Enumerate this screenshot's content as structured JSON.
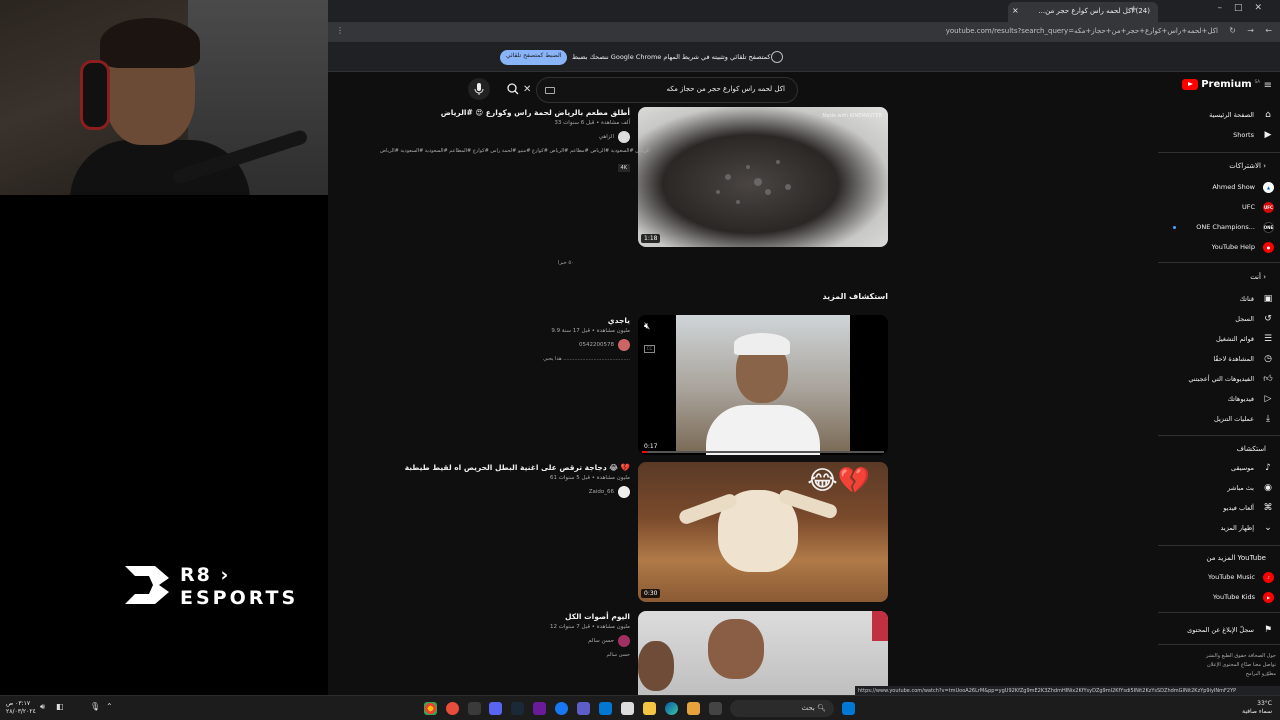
{
  "browser": {
    "tab_title": "(24) اكل لحمه راس كوارع حجر من...",
    "tab_close": "×",
    "new_tab": "+",
    "url": "youtube.com/results?search_query=اكل+لحمه+راس+كوارع+حجر+من+حجاز+مكه",
    "infobar_text": "ننصحك بضبط Google Chrome كمتصفح تلقائي وتثبيته في شريط المهام",
    "infobar_button": "الضبط كمتصفح تلقائي"
  },
  "youtube": {
    "logo_text": "Premium",
    "logo_region": "SA",
    "search_query": "اكل لحمه راس كوارع حجر من حجاز مكه",
    "clear": "✕"
  },
  "sidebar": {
    "main": [
      {
        "label": "الصفحة الرئيسية",
        "icon": "home-icon"
      },
      {
        "label": "Shorts",
        "icon": "shorts-icon"
      }
    ],
    "subscriptions_header": "الاشتراكات",
    "subscriptions": [
      {
        "label": "Ahmed Show",
        "icon": "channel-avatar"
      },
      {
        "label": "UFC",
        "icon": "channel-avatar",
        "avatar_text": "UFC"
      },
      {
        "label": "ONE Champions...",
        "icon": "channel-avatar",
        "avatar_text": "ONE"
      },
      {
        "label": "YouTube Help",
        "icon": "channel-avatar"
      }
    ],
    "you_header": "أنت",
    "you": [
      {
        "label": "قناتك",
        "icon": "account-box-icon"
      },
      {
        "label": "السجل",
        "icon": "history-icon"
      },
      {
        "label": "قوائم التشغيل",
        "icon": "playlists-icon"
      },
      {
        "label": "المشاهدة لاحقًا",
        "icon": "clock-icon"
      },
      {
        "label": "الفيديوهات التي أعجبتني",
        "icon": "thumbs-up-icon"
      },
      {
        "label": "فيديوهاتك",
        "icon": "your-videos-icon"
      },
      {
        "label": "عمليات التنزيل",
        "icon": "download-icon"
      }
    ],
    "explore_header": "استكشاف",
    "explore": [
      {
        "label": "موسيقى",
        "icon": "music-icon"
      },
      {
        "label": "بث مباشر",
        "icon": "live-icon"
      },
      {
        "label": "ألعاب فيديو",
        "icon": "gaming-icon"
      },
      {
        "label": "إظهار المزيد",
        "icon": "chevron-down-icon"
      }
    ],
    "more_header": "المزيد من YouTube",
    "more": [
      {
        "label": "YouTube Music",
        "icon": "yt-music-icon"
      },
      {
        "label": "YouTube Kids",
        "icon": "yt-kids-icon"
      }
    ],
    "report": {
      "label": "سجلّ الإبلاغ عن المحتوى",
      "icon": "flag-icon"
    },
    "footer": [
      "حول  الصحافة  حقوق الطبع والنشر",
      "تواصل معنا  صنّاع المحتوى  الإعلان",
      "مطوّرو البرامج"
    ]
  },
  "results": {
    "section_header": "استكشاف المزيد",
    "more_label": "٥٠ خبرا",
    "items": [
      {
        "title": "أطلق مطعم بالرياض لحمة راس وكوارع 😍 #الرياض",
        "stats": "33 ألف مشاهدة • قبل 6 سنوات",
        "channel": "الزاهي",
        "desc": "الرياض #السعودية #الرياض #مطاعم #الرياض #كوارع #منيو #لحمة راس #كوارع #المطاعم #السعودية #السعودية #الرياض",
        "badge": "4K",
        "duration": "1:18",
        "watermark": "Made with KINEMASTER"
      },
      {
        "title": "ياجدي",
        "stats": "9.9 مليون مشاهدة • قبل 17 سنة",
        "channel": "0542200578",
        "desc": "هذا يحبي ..........................................",
        "duration": "0:17"
      },
      {
        "title": "دجاجة ترقص على اغنية البطل الحريص اه لقيط طيطبة 😂 💔",
        "stats": "61 مليون مشاهدة • قبل 5 سنوات",
        "channel": "Zaido_66",
        "duration": "0:30",
        "emoji": "😂💔"
      },
      {
        "title": "اليوم أصوات الكل",
        "stats": "12 مليون مشاهدة • قبل 7 سنوات",
        "channel": "حسن سالم",
        "desc": "حسن سالم"
      }
    ]
  },
  "overlay": {
    "brand_line1": "R8 ›",
    "brand_line2": "ESPORTS"
  },
  "status_url": "https://www.youtube.com/watch?v=tmUooA26LrM&pp=ygU92KfZg9mE2K3ZhdmHINix2KfYsyDZg9mI2KfYsdi5INit2KzYsSDZhdmGINit2KzYp9iyINmF2YP",
  "taskbar": {
    "search": "بحث",
    "time": "٠٣:١٧ ص",
    "date": "٢٨/٠٣/٢٠٢٤",
    "weather": "33°C",
    "weather_desc": "سماء صافية"
  },
  "colors": {
    "yt_red": "#ff0000",
    "chrome_blue": "#8ab4f8",
    "bg": "#0f0f0f"
  }
}
